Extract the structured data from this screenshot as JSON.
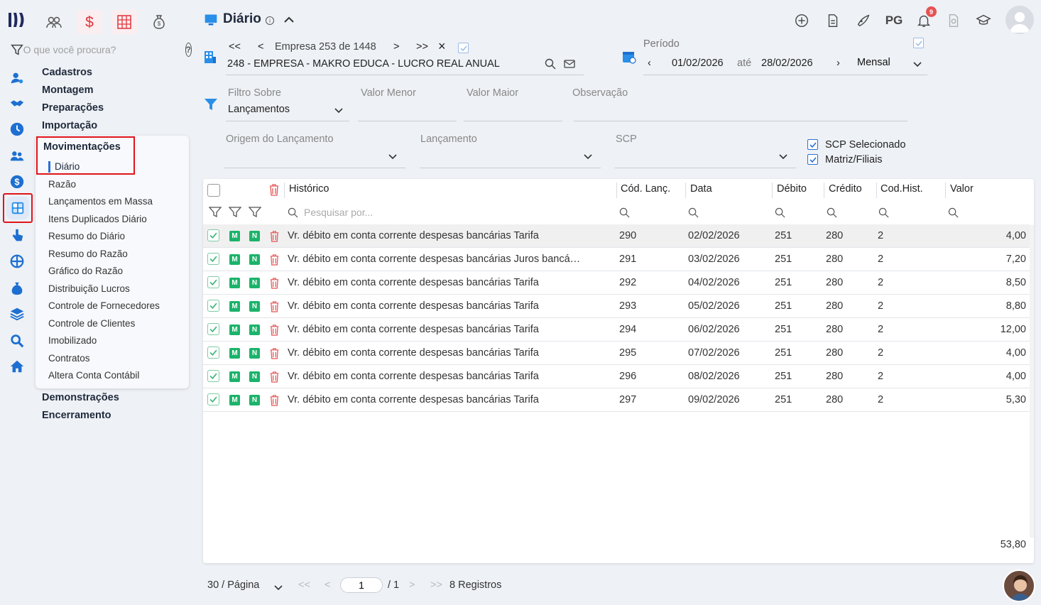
{
  "app": {
    "title": "Diário"
  },
  "search": {
    "placeholder": "O que você procura?"
  },
  "menu": {
    "sections_top": [
      "Cadastros",
      "Montagem",
      "Preparações",
      "Importação"
    ],
    "active_section": "Movimentações",
    "items": [
      "Diário",
      "Razão",
      "Lançamentos em Massa",
      "Itens Duplicados Diário",
      "Resumo do Diário",
      "Resumo do Razão",
      "Gráfico do Razão",
      "Distribuição Lucros",
      "Controle de Fornecedores",
      "Controle de Clientes",
      "Imobilizado",
      "Contratos",
      "Altera Conta Contábil"
    ],
    "sections_bottom": [
      "Demonstrações",
      "Encerramento"
    ]
  },
  "header": {
    "notifications_count": "9",
    "pg_label": "PG"
  },
  "empresa": {
    "first": "<<",
    "prev": "<",
    "label": "Empresa 253 de 1448",
    "next": ">",
    "last": ">>",
    "close": "×",
    "name": "248 - EMPRESA - MAKRO EDUCA - LUCRO REAL ANUAL"
  },
  "periodo": {
    "label": "Período",
    "start": "01/02/2026",
    "ate": "até",
    "end": "28/02/2026",
    "mode": "Mensal"
  },
  "filters": {
    "filtro_sobre_label": "Filtro Sobre",
    "filtro_sobre_value": "Lançamentos",
    "valor_menor_label": "Valor Menor",
    "valor_maior_label": "Valor Maior",
    "observacao_label": "Observação",
    "origem_label": "Origem do Lançamento",
    "lancamento_label": "Lançamento",
    "scp_label": "SCP",
    "scp_selecionado": "SCP Selecionado",
    "matriz_filiais": "Matriz/Filiais"
  },
  "grid": {
    "columns": [
      "Histórico",
      "Cód. Lanç.",
      "Data",
      "Débito",
      "Crédito",
      "Cod.Hist.",
      "Valor"
    ],
    "search_placeholder": "Pesquisar por...",
    "rows": [
      {
        "m": "M",
        "n": "N",
        "historico": "Vr. débito em conta corrente despesas bancárias Tarifa",
        "cod": "290",
        "data": "02/02/2026",
        "debito": "251",
        "credito": "280",
        "codhist": "2",
        "valor": "4,00"
      },
      {
        "m": "M",
        "n": "N",
        "historico": "Vr. débito em conta corrente despesas bancárias Juros bancá…",
        "cod": "291",
        "data": "03/02/2026",
        "debito": "251",
        "credito": "280",
        "codhist": "2",
        "valor": "7,20"
      },
      {
        "m": "M",
        "n": "N",
        "historico": "Vr. débito em conta corrente despesas bancárias Tarifa",
        "cod": "292",
        "data": "04/02/2026",
        "debito": "251",
        "credito": "280",
        "codhist": "2",
        "valor": "8,50"
      },
      {
        "m": "M",
        "n": "N",
        "historico": "Vr. débito em conta corrente despesas bancárias Tarifa",
        "cod": "293",
        "data": "05/02/2026",
        "debito": "251",
        "credito": "280",
        "codhist": "2",
        "valor": "8,80"
      },
      {
        "m": "M",
        "n": "N",
        "historico": "Vr. débito em conta corrente despesas bancárias Tarifa",
        "cod": "294",
        "data": "06/02/2026",
        "debito": "251",
        "credito": "280",
        "codhist": "2",
        "valor": "12,00"
      },
      {
        "m": "M",
        "n": "N",
        "historico": "Vr. débito em conta corrente despesas bancárias Tarifa",
        "cod": "295",
        "data": "07/02/2026",
        "debito": "251",
        "credito": "280",
        "codhist": "2",
        "valor": "4,00"
      },
      {
        "m": "M",
        "n": "N",
        "historico": "Vr. débito em conta corrente despesas bancárias Tarifa",
        "cod": "296",
        "data": "08/02/2026",
        "debito": "251",
        "credito": "280",
        "codhist": "2",
        "valor": "4,00"
      },
      {
        "m": "M",
        "n": "N",
        "historico": "Vr. débito em conta corrente despesas bancárias Tarifa",
        "cod": "297",
        "data": "09/02/2026",
        "debito": "251",
        "credito": "280",
        "codhist": "2",
        "valor": "5,30"
      }
    ],
    "total": "53,80"
  },
  "pagination": {
    "per_page": "30 / Página",
    "first": "<<",
    "prev": "<",
    "page": "1",
    "of": "/ 1",
    "next": ">",
    "last": ">>",
    "records": "8 Registros"
  },
  "colors": {
    "accent": "#2b6fd4",
    "highlight": "#e0141b",
    "green": "#1bb36a",
    "delete": "#e55353"
  }
}
